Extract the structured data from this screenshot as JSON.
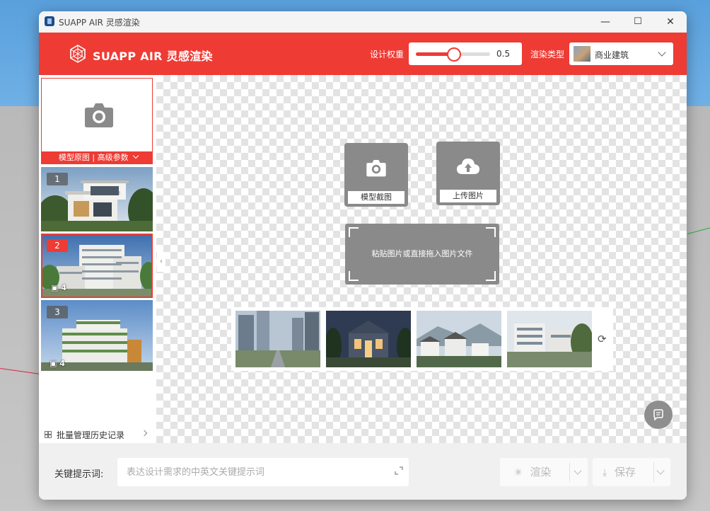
{
  "window": {
    "title": "SUAPP AIR 灵感渲染"
  },
  "window_controls": {
    "minimize": "—",
    "maximize": "☐",
    "close": "✕"
  },
  "header": {
    "brand": "SUAPP AIR 灵感渲染",
    "weight_label": "设计权重",
    "weight_value": "0.5",
    "weight_fraction": 0.5,
    "render_type_label": "渲染类型",
    "render_type_value": "商业建筑"
  },
  "sidebar": {
    "main_label": "模型原图 | 高级参数",
    "history": [
      {
        "number": "1",
        "count": "",
        "selected": false
      },
      {
        "number": "2",
        "count": "4",
        "selected": true
      },
      {
        "number": "3",
        "count": "4",
        "selected": false
      }
    ],
    "batch_label": "批量管理历史记录"
  },
  "canvas": {
    "capture_label": "模型截图",
    "upload_label": "上传图片",
    "drop_text": "粘贴图片或直接拖入图片文件"
  },
  "footer": {
    "keyword_label": "关键提示词:",
    "keyword_placeholder": "表达设计需求的中英文关键提示词",
    "render_label": "渲染",
    "save_label": "保存"
  },
  "colors": {
    "brand_red": "#ee3b34",
    "checker": "#e3e3e3",
    "tile_gray": "#8a8a8a"
  }
}
